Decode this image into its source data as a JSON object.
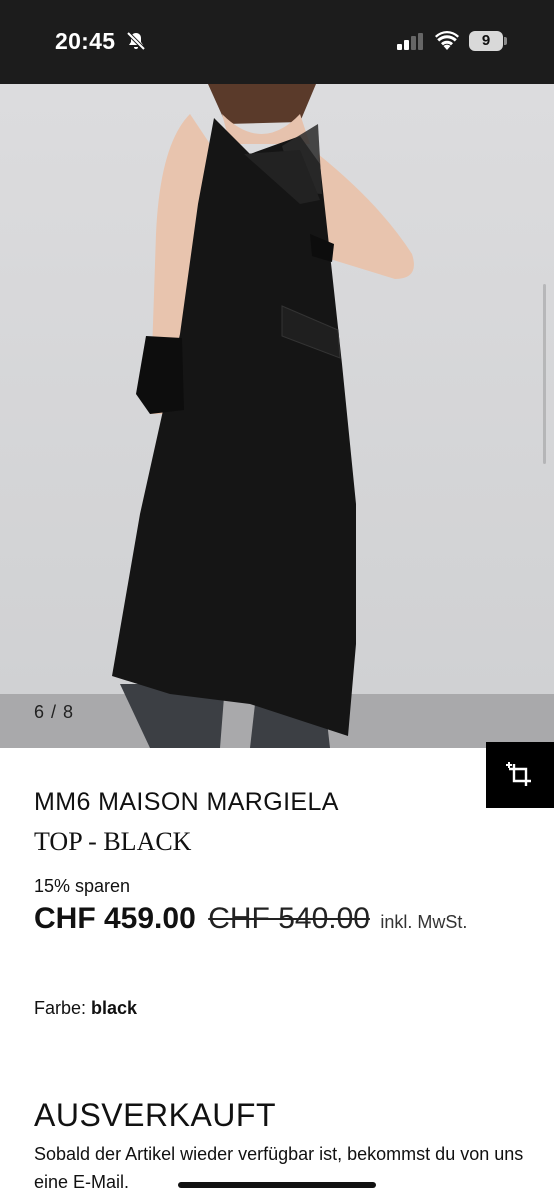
{
  "status_bar": {
    "time": "20:45",
    "battery_level": "9",
    "icons": [
      "bell-slash-icon",
      "signal-icon",
      "wifi-icon",
      "battery-icon"
    ]
  },
  "gallery": {
    "page_indicator": "6 / 8",
    "image_subject": "model-wearing-black-asymmetric-dress"
  },
  "product": {
    "brand": "MM6 MAISON MARGIELA",
    "name": "TOP - BLACK",
    "discount": "15% sparen",
    "price_current": "CHF 459.00",
    "price_old": "CHF 540.00",
    "tax_note": "inkl. MwSt.",
    "color_label": "Farbe:",
    "color_value": "black"
  },
  "availability": {
    "status": "AUSVERKAUFT",
    "notice": "Sobald der Artikel wieder verfügbar ist, bekommst du von uns eine E-Mail."
  },
  "colors": {
    "status_bar_bg": "#1c1c1c",
    "backdrop": "#d9d9db",
    "garment": "#151515",
    "accent": "#000000"
  }
}
